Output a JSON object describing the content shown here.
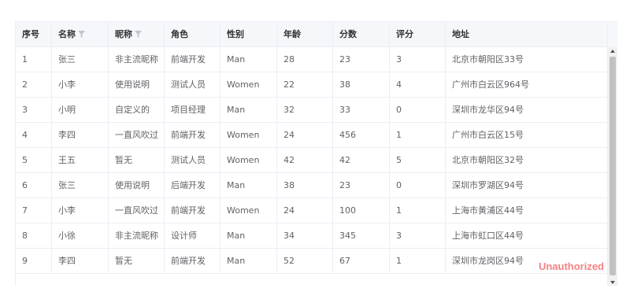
{
  "table": {
    "columns": [
      {
        "label": "序号",
        "filter": false
      },
      {
        "label": "名称",
        "filter": true
      },
      {
        "label": "昵称",
        "filter": true
      },
      {
        "label": "角色",
        "filter": false
      },
      {
        "label": "性别",
        "filter": false
      },
      {
        "label": "年龄",
        "filter": false
      },
      {
        "label": "分数",
        "filter": false
      },
      {
        "label": "评分",
        "filter": false
      },
      {
        "label": "地址",
        "filter": false
      }
    ],
    "rows": [
      [
        "1",
        "张三",
        "非主流昵称",
        "前端开发",
        "Man",
        "28",
        "23",
        "3",
        "北京市朝阳区33号"
      ],
      [
        "2",
        "小李",
        "使用说明",
        "测试人员",
        "Women",
        "22",
        "38",
        "4",
        "广州市白云区964号"
      ],
      [
        "3",
        "小明",
        "自定义的",
        "项目经理",
        "Man",
        "32",
        "33",
        "0",
        "深圳市龙华区94号"
      ],
      [
        "4",
        "李四",
        "一直风吹过",
        "前端开发",
        "Women",
        "24",
        "456",
        "1",
        "广州市白云区15号"
      ],
      [
        "5",
        "王五",
        "暂无",
        "测试人员",
        "Women",
        "42",
        "42",
        "5",
        "北京市朝阳区32号"
      ],
      [
        "6",
        "张三",
        "使用说明",
        "后端开发",
        "Man",
        "38",
        "23",
        "0",
        "深圳市罗湖区94号"
      ],
      [
        "7",
        "小李",
        "一直风吹过",
        "前端开发",
        "Women",
        "24",
        "100",
        "1",
        "上海市黄浦区44号"
      ],
      [
        "8",
        "小徐",
        "非主流昵称",
        "设计师",
        "Man",
        "34",
        "345",
        "3",
        "上海市虹口区44号"
      ],
      [
        "9",
        "李四",
        "暂无",
        "前端开发",
        "Man",
        "52",
        "67",
        "1",
        "深圳市龙岗区94号"
      ]
    ]
  },
  "watermark": "Unauthorized",
  "colors": {
    "header_bg": "#f5f7fa",
    "border": "#ebeef5",
    "watermark": "#f56c6c"
  }
}
